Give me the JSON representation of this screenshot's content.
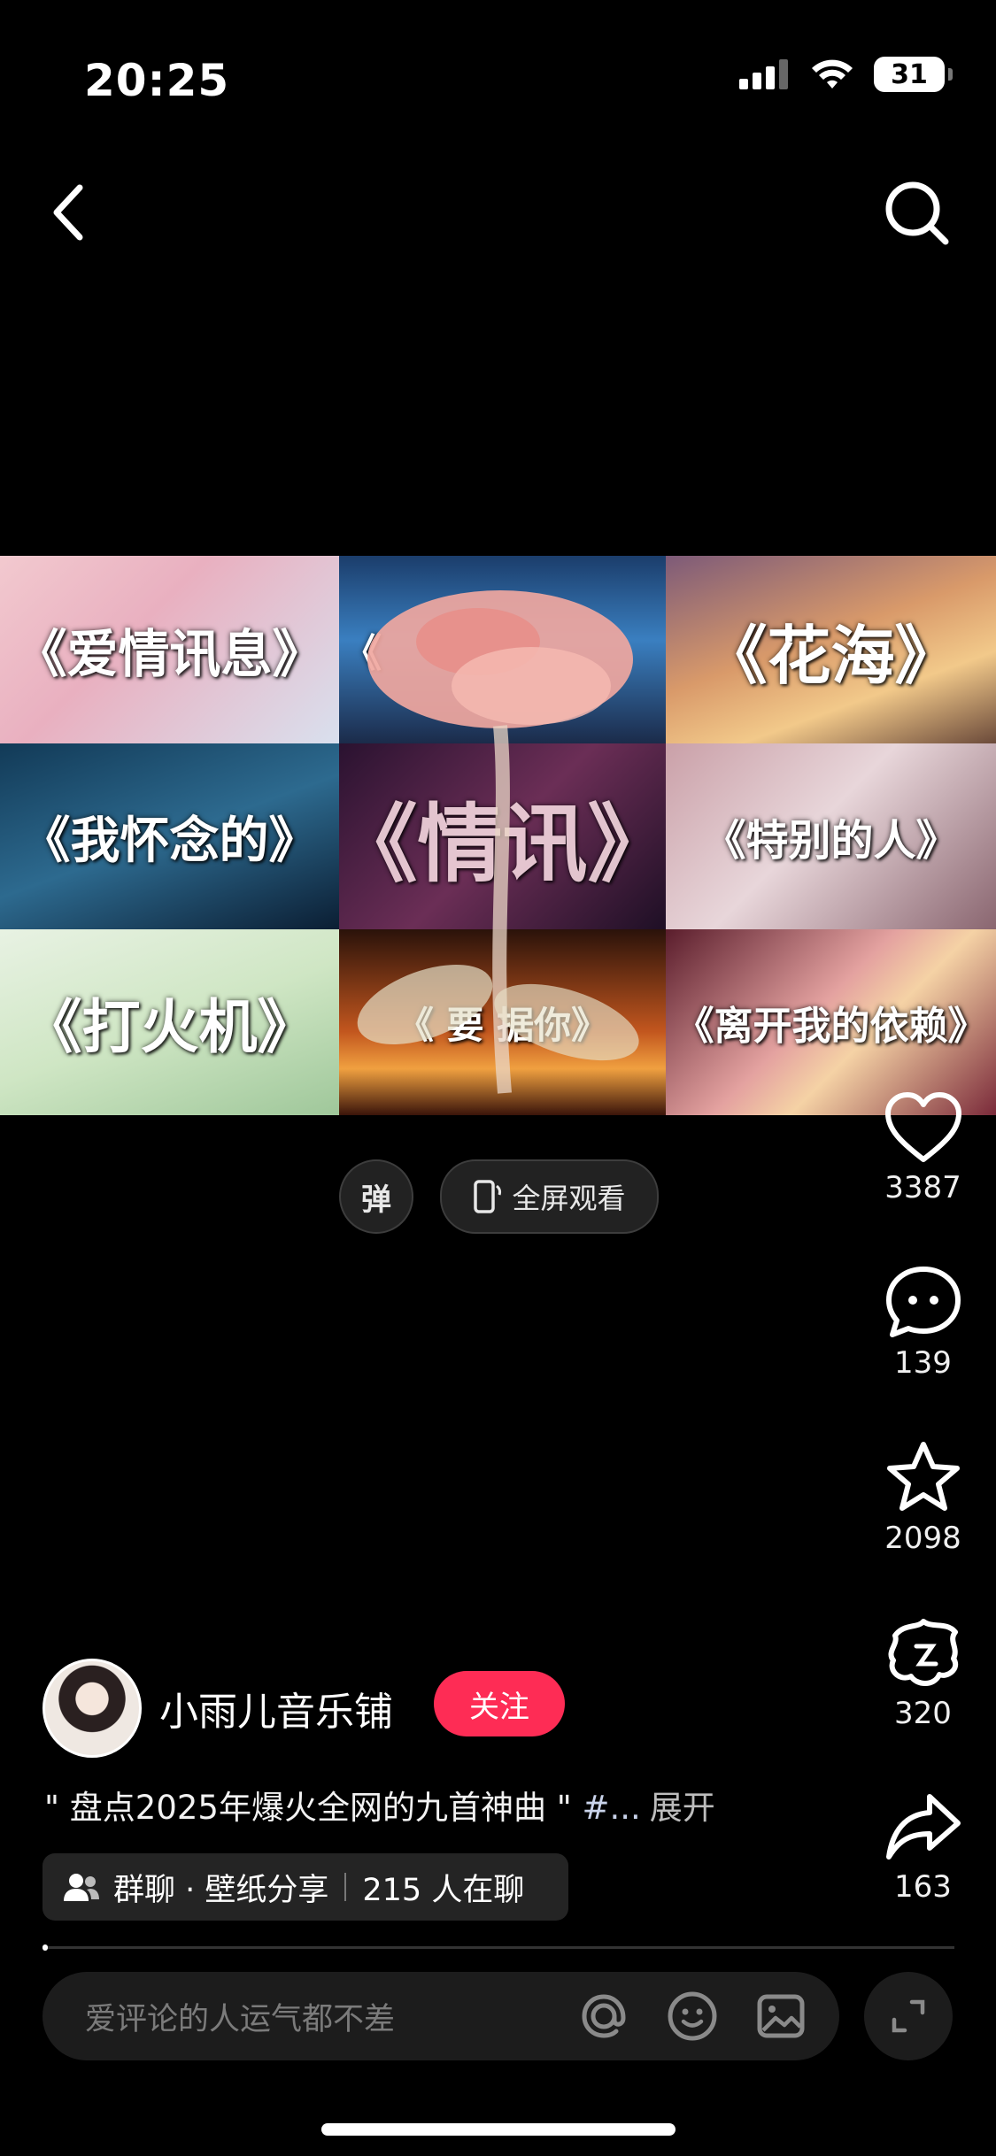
{
  "status_bar": {
    "time": "20:25",
    "battery": "31",
    "icons": [
      "signal-icon",
      "wifi-icon",
      "battery-icon"
    ]
  },
  "nav": {
    "back_icon": "chevron-left-icon",
    "search_icon": "search-icon"
  },
  "video": {
    "tiles": [
      "《爱情讯息》",
      "《",
      "《花海》",
      "《我怀念的》",
      "《情讯》",
      "《特别的人》",
      "《打火机》",
      "《 要 据你》",
      "《离开我的依赖》"
    ]
  },
  "video_controls": {
    "danmu_label": "弹",
    "fullscreen_label": "全屏观看"
  },
  "actions": {
    "like_count": "3387",
    "comment_count": "139",
    "favorite_count": "2098",
    "share_friend_count": "320",
    "share_count": "163"
  },
  "author": {
    "name": "小雨儿音乐铺",
    "follow_label": "关注"
  },
  "description": {
    "text": "\" 盘点2025年爆火全网的九首神曲 \" ",
    "tag": "#...",
    "expand": "展开"
  },
  "group_chat": {
    "name": "群聊 · 壁纸分享",
    "online": "215 人在聊"
  },
  "comment": {
    "placeholder": "爱评论的人运气都不差"
  },
  "colors": {
    "accent": "#fe2c55",
    "background": "#000000",
    "bar": "#1c1c1c"
  }
}
